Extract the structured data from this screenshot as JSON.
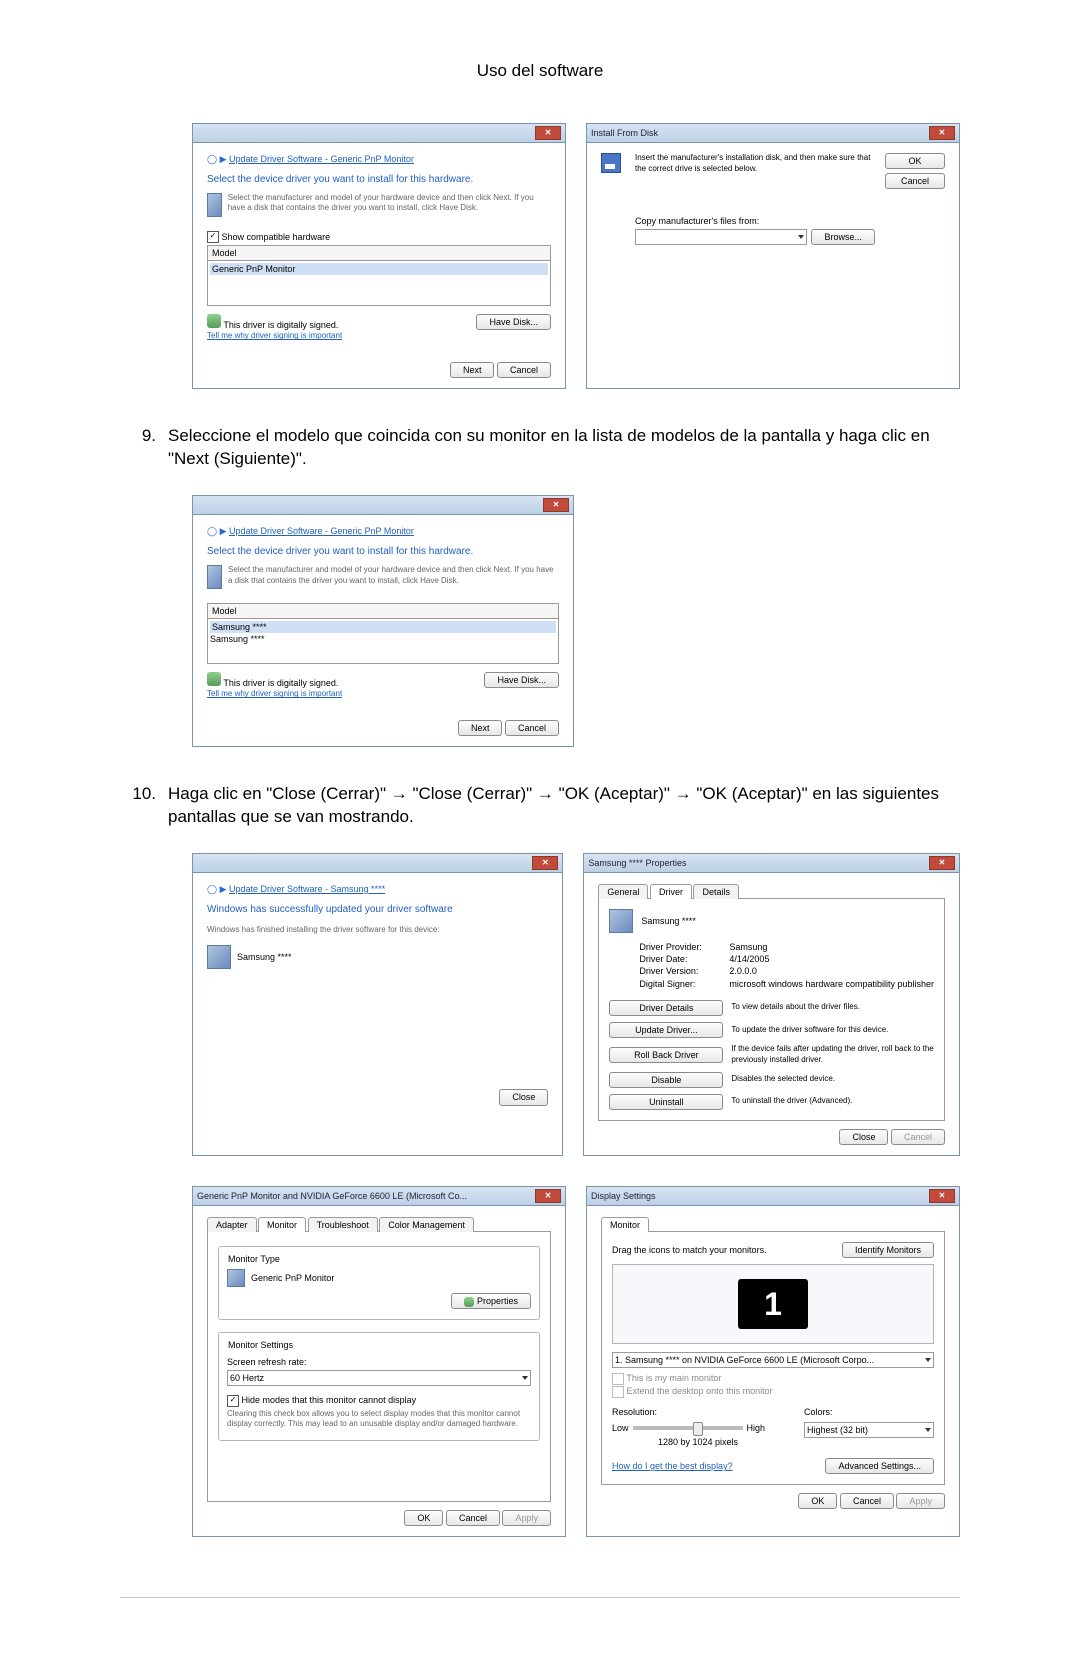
{
  "page": {
    "title": "Uso del software"
  },
  "steps": {
    "s9_num": "9.",
    "s9": "Seleccione el modelo que coincida con su monitor en la lista de modelos de la pantalla y haga clic en \"Next (Siguiente)\".",
    "s10_num": "10.",
    "s10": "Haga clic en \"Close (Cerrar)\" → \"Close (Cerrar)\" → \"OK (Aceptar)\" → \"OK (Aceptar)\" en las siguientes pantallas que se van mostrando."
  },
  "dlgA": {
    "breadcrumb": "Update Driver Software - Generic PnP Monitor",
    "heading": "Select the device driver you want to install for this hardware.",
    "instr": "Select the manufacturer and model of your hardware device and then click Next. If you have a disk that contains the driver you want to install, click Have Disk.",
    "check": "Show compatible hardware",
    "col": "Model",
    "row0": "Generic PnP Monitor",
    "signed": "This driver is digitally signed.",
    "tellme": "Tell me why driver signing is important",
    "havedisk": "Have Disk...",
    "next": "Next",
    "cancel": "Cancel"
  },
  "dlgB": {
    "title": "Install From Disk",
    "instr": "Insert the manufacturer's installation disk, and then make sure that the correct drive is selected below.",
    "ok": "OK",
    "cancel": "Cancel",
    "copy": "Copy manufacturer's files from:",
    "browse": "Browse..."
  },
  "dlgC": {
    "breadcrumb": "Update Driver Software - Generic PnP Monitor",
    "heading": "Select the device driver you want to install for this hardware.",
    "instr": "Select the manufacturer and model of your hardware device and then click Next. If you have a disk that contains the driver you want to install, click Have Disk.",
    "col": "Model",
    "row0": "Samsung ****",
    "row1": "Samsung ****",
    "signed": "This driver is digitally signed.",
    "tellme": "Tell me why driver signing is important",
    "havedisk": "Have Disk...",
    "next": "Next",
    "cancel": "Cancel"
  },
  "dlgD": {
    "breadcrumb": "Update Driver Software - Samsung ****",
    "heading": "Windows has successfully updated your driver software",
    "instr": "Windows has finished installing the driver software for this device:",
    "device": "Samsung ****",
    "close": "Close"
  },
  "dlgE": {
    "title": "Samsung **** Properties",
    "tabs": [
      "General",
      "Driver",
      "Details"
    ],
    "device": "Samsung ****",
    "prov_label": "Driver Provider:",
    "prov_val": "Samsung",
    "date_label": "Driver Date:",
    "date_val": "4/14/2005",
    "ver_label": "Driver Version:",
    "ver_val": "2.0.0.0",
    "signer_label": "Digital Signer:",
    "signer_val": "microsoft windows hardware compatibility publisher",
    "btn_details": "Driver Details",
    "txt_details": "To view details about the driver files.",
    "btn_update": "Update Driver...",
    "txt_update": "To update the driver software for this device.",
    "btn_rollback": "Roll Back Driver",
    "txt_rollback": "If the device fails after updating the driver, roll back to the previously installed driver.",
    "btn_disable": "Disable",
    "txt_disable": "Disables the selected device.",
    "btn_uninstall": "Uninstall",
    "txt_uninstall": "To uninstall the driver (Advanced).",
    "close": "Close",
    "cancel": "Cancel"
  },
  "dlgF": {
    "title": "Generic PnP Monitor and NVIDIA GeForce 6600 LE (Microsoft Co...",
    "tabs": [
      "Adapter",
      "Monitor",
      "Troubleshoot",
      "Color Management"
    ],
    "mt_legend": "Monitor Type",
    "mt_val": "Generic PnP Monitor",
    "properties": "Properties",
    "ms_legend": "Monitor Settings",
    "refresh_label": "Screen refresh rate:",
    "refresh_val": "60 Hertz",
    "hide_check": "Hide modes that this monitor cannot display",
    "hide_note": "Clearing this check box allows you to select display modes that this monitor cannot display correctly. This may lead to an unusable display and/or damaged hardware.",
    "ok": "OK",
    "cancel": "Cancel",
    "apply": "Apply"
  },
  "dlgG": {
    "title": "Display Settings",
    "tabs": [
      "Monitor"
    ],
    "drag": "Drag the icons to match your monitors.",
    "identify": "Identify Monitors",
    "num": "1",
    "monitor_sel": "1. Samsung **** on NVIDIA GeForce 6600 LE (Microsoft Corpo...",
    "main": "This is my main monitor",
    "extend": "Extend the desktop onto this monitor",
    "res_label": "Resolution:",
    "res_low": "Low",
    "res_high": "High",
    "res_val": "1280 by 1024 pixels",
    "col_label": "Colors:",
    "col_val": "Highest (32 bit)",
    "howdo": "How do I get the best display?",
    "advanced": "Advanced Settings...",
    "ok": "OK",
    "cancel": "Cancel",
    "apply": "Apply"
  }
}
